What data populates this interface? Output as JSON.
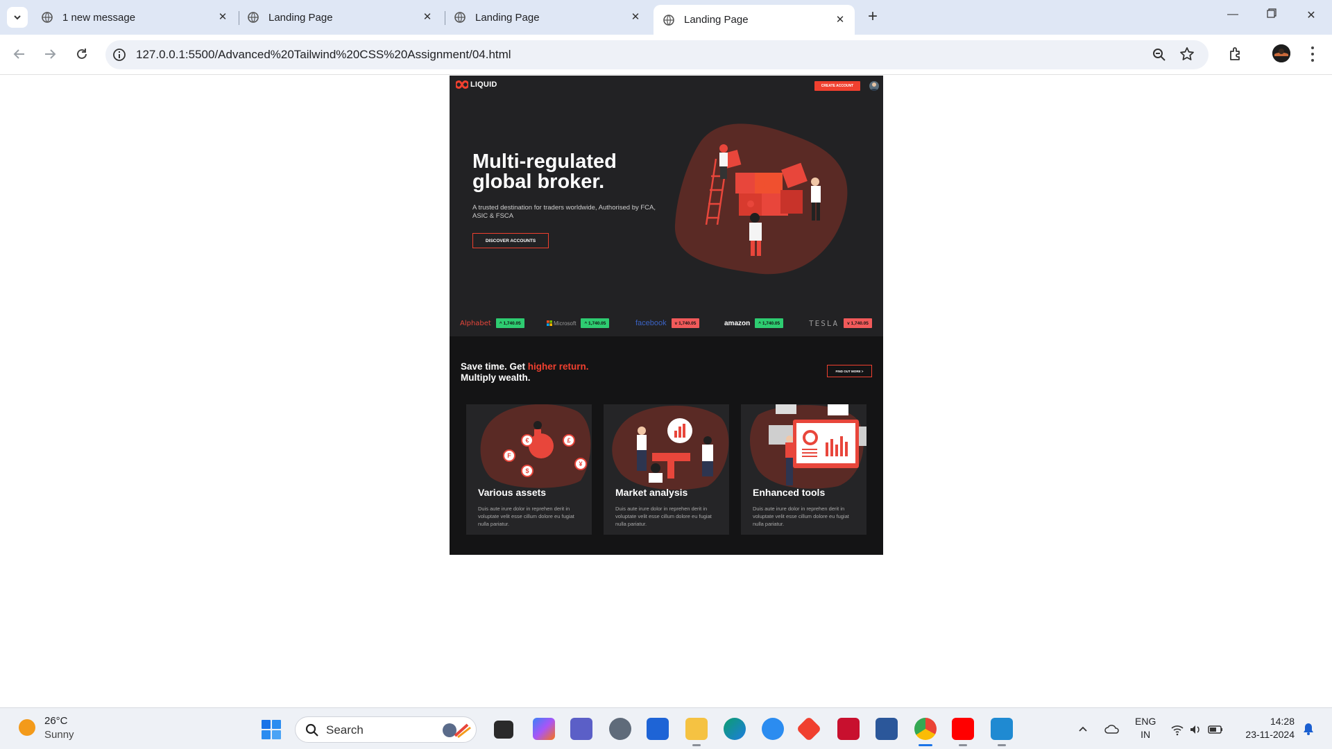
{
  "browser": {
    "tabs": [
      {
        "title": "1 new message",
        "active": false
      },
      {
        "title": "Landing Page",
        "active": false
      },
      {
        "title": "Landing Page",
        "active": false
      },
      {
        "title": "Landing Page",
        "active": true
      }
    ],
    "address": "127.0.0.1:5500/Advanced%20Tailwind%20CSS%20Assignment/04.html"
  },
  "site": {
    "logo": "LIQUID",
    "create_account": "CREATE ACCOUNT",
    "hero": {
      "title": "Multi-regulated global broker.",
      "subtitle": "A trusted destination for traders worldwide, Authorised by FCA, ASIC & FSCA",
      "cta": "DISCOVER ACCOUNTS"
    },
    "ticker": [
      {
        "brand": "Alphabet",
        "price": "^ 1,740.05",
        "direction": "up",
        "brand_color": "#e8463b"
      },
      {
        "brand": "Microsoft",
        "price": "^ 1,740.05",
        "direction": "up",
        "brand_color": "#9a9a9a"
      },
      {
        "brand": "facebook",
        "price": "v 1,740.05",
        "direction": "down",
        "brand_color": "#3b63c4"
      },
      {
        "brand": "amazon",
        "price": "^ 1,740.05",
        "direction": "up",
        "brand_color": "#ffffff"
      },
      {
        "brand": "TESLA",
        "price": "v 1,740.05",
        "direction": "down",
        "brand_color": "#9a9a9a"
      }
    ],
    "section": {
      "heading_prefix": "Save time. Get ",
      "heading_highlight": "higher return.",
      "heading_line2": "Multiply wealth.",
      "find_out": "FIND OUT MORE >"
    },
    "cards": [
      {
        "title": "Various assets",
        "text": "Duis aute irure dolor in reprehen derit in voluptate velit esse cillum dolore eu fugiat nulla pariatur."
      },
      {
        "title": "Market analysis",
        "text": "Duis aute irure dolor in reprehen derit in voluptate velit esse cillum dolore eu fugiat nulla pariatur."
      },
      {
        "title": "Enhanced tools",
        "text": "Duis aute irure dolor in reprehen derit in voluptate velit esse cillum dolore eu fugiat nulla pariatur."
      }
    ],
    "colors": {
      "accent": "#f0402f",
      "up": "#2ecc71",
      "down": "#f15a5a",
      "bg": "#222224",
      "bg_dark": "#141415"
    }
  },
  "taskbar": {
    "weather_temp": "26°C",
    "weather_desc": "Sunny",
    "search_placeholder": "Search",
    "lang_line1": "ENG",
    "lang_line2": "IN",
    "time": "14:28",
    "date": "23-11-2024",
    "apps": [
      "file-explorer-icon",
      "copilot-icon",
      "teams-icon",
      "settings-icon",
      "store-icon",
      "folder-icon",
      "edge-icon",
      "weather-app-icon",
      "git-icon",
      "mcafee-icon",
      "word-icon",
      "chrome-icon",
      "youtube-icon",
      "vscode-icon"
    ]
  }
}
